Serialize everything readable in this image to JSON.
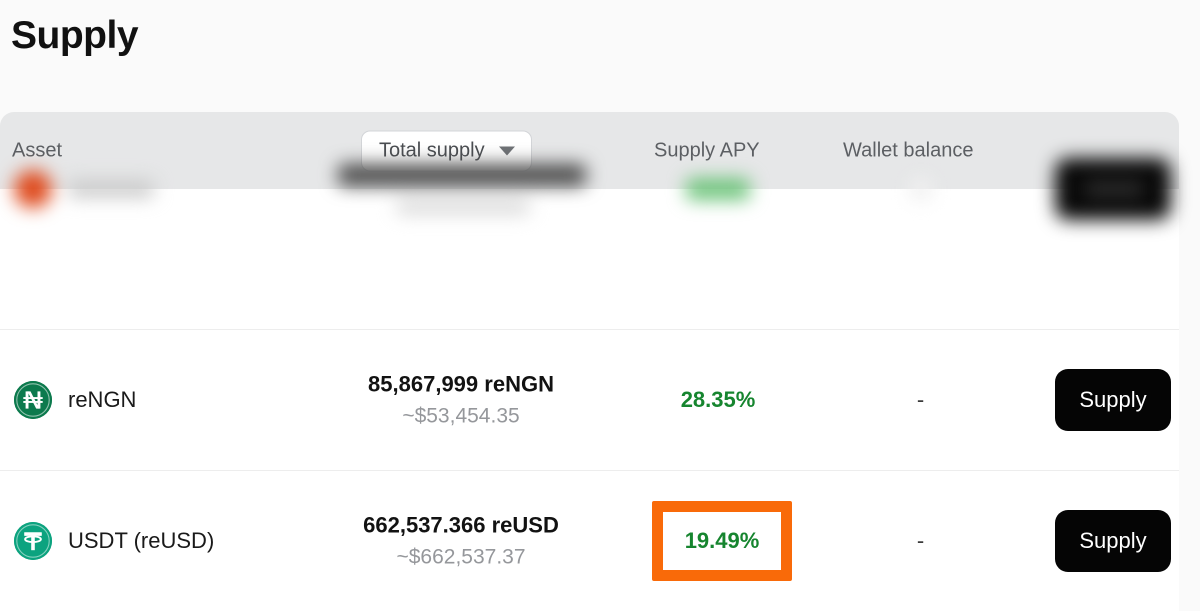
{
  "page": {
    "title": "Supply",
    "background_color": "#fafafa"
  },
  "table": {
    "header": {
      "background_color": "#e6e7e8",
      "columns": {
        "asset": "Asset",
        "supply_apy": "Supply APY",
        "wallet_balance": "Wallet balance"
      },
      "sort_select": {
        "name": "total-supply-sort",
        "selected_value": "Total supply",
        "caret_icon": "chevron-down-icon"
      }
    },
    "rows": [
      {
        "obscured": true,
        "icon": "blurred-coin-icon",
        "icon_color": "#de4a1d",
        "asset": "",
        "supply_amount": "",
        "supply_usd": "",
        "supply_apy": "",
        "wallet_balance": "",
        "action_label": ""
      },
      {
        "obscured": false,
        "icon": "naira-coin-icon",
        "icon_color": "#0c7a4d",
        "icon_glyph": "₦",
        "asset": "reNGN",
        "supply_amount": "85,867,999 reNGN",
        "supply_usd": "~$53,454.35",
        "supply_apy": "28.35%",
        "apy_color": "#16852f",
        "apy_highlighted": false,
        "wallet_balance": "-",
        "action_label": "Supply"
      },
      {
        "obscured": false,
        "icon": "tether-coin-icon",
        "icon_color": "#0ca37f",
        "icon_glyph": "₮",
        "asset": "USDT (reUSD)",
        "supply_amount": "662,537.366 reUSD",
        "supply_usd": "~$662,537.37",
        "supply_apy": "19.49%",
        "apy_color": "#16852f",
        "apy_highlighted": true,
        "highlight_color": "#f96a09",
        "wallet_balance": "-",
        "action_label": "Supply"
      }
    ]
  }
}
